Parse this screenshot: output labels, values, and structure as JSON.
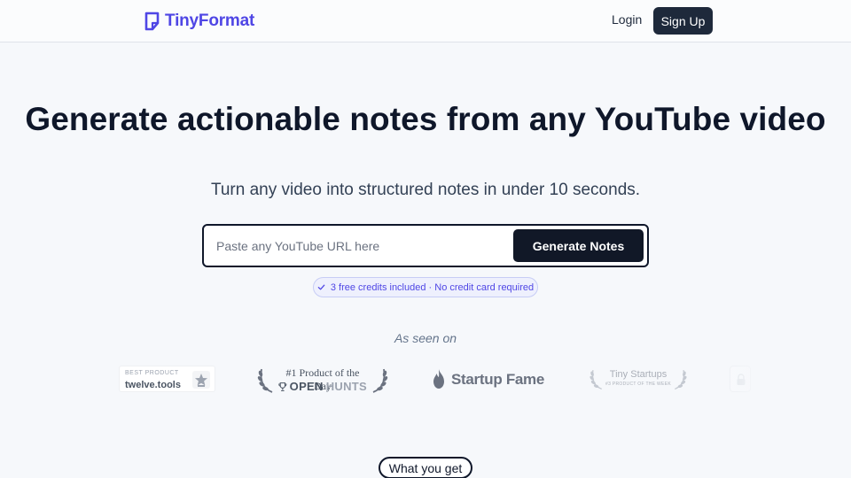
{
  "header": {
    "brand_name": "TinyFormat",
    "login_label": "Login",
    "signup_label": "Sign Up"
  },
  "hero": {
    "title": "Generate actionable notes from any YouTube video",
    "subtitle": "Turn any video into structured notes in under 10 seconds.",
    "url_input_placeholder": "Paste any YouTube URL here",
    "url_input_value": "",
    "generate_label": "Generate Notes",
    "credits_text": "3 free credits included · No credit card required"
  },
  "seen_on": {
    "label": "As seen on",
    "logos": [
      {
        "name": "twelve.tools",
        "top_text": "BEST PRODUCT",
        "icon": "star-icon"
      },
      {
        "name": "OPENHUNTS",
        "name_part1": "OPEN",
        "name_part2": "HUNTS",
        "top_text": "#1 Product of the Day",
        "icon": "trophy-icon"
      },
      {
        "name": "Startup Fame",
        "icon": "flame-icon"
      },
      {
        "name": "Tiny Startups",
        "sub_text": "#3 PRODUCT OF THE WEEK",
        "icon": "laurel-icon"
      },
      {
        "name": "",
        "icon": "lock-icon"
      }
    ]
  },
  "section": {
    "what_you_get_label": "What you get"
  },
  "colors": {
    "brand": "#4f46e5",
    "dark": "#0f172a",
    "background": "#f6f8fb"
  }
}
